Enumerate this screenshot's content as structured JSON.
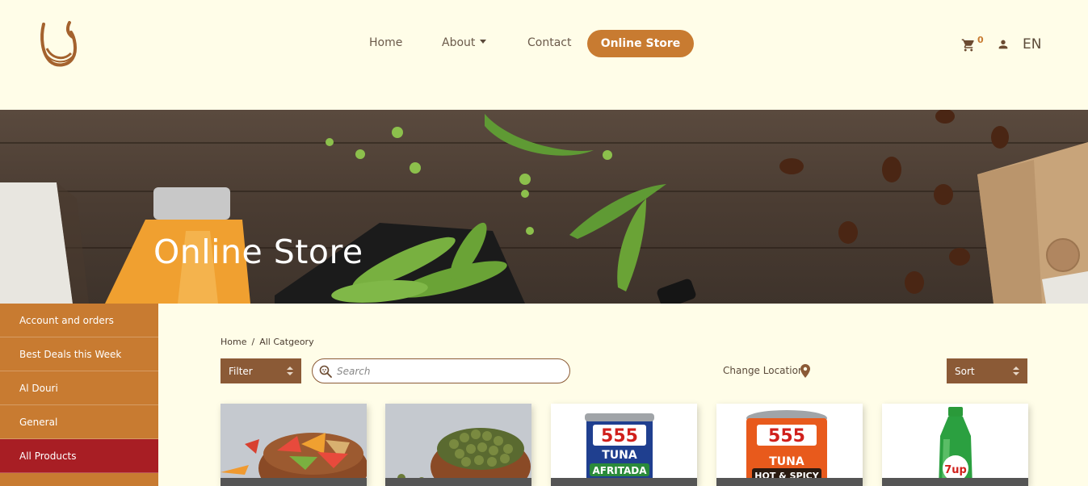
{
  "header": {
    "nav": {
      "home": "Home",
      "about": "About",
      "contact": "Contact",
      "online_store": "Online Store"
    },
    "cart_count": "0",
    "language": "EN"
  },
  "hero": {
    "title": "Online Store"
  },
  "sidebar": {
    "items": [
      {
        "label": "Account and orders"
      },
      {
        "label": "Best Deals this Week"
      },
      {
        "label": "Al Douri"
      },
      {
        "label": "General"
      },
      {
        "label": "All Products"
      }
    ],
    "active_index": 4
  },
  "breadcrumb": {
    "home": "Home",
    "separator": "/",
    "current": "All Catgeory"
  },
  "toolbar": {
    "filter_label": "Filter",
    "search_placeholder": "Search",
    "change_location": "Change Location",
    "sort_label": "Sort"
  },
  "products": [
    {
      "image": "mixed-snack-crackers-bowl"
    },
    {
      "image": "roasted-green-peas-bowl"
    },
    {
      "image": "555-tuna-afritada-can",
      "brand": "555",
      "product": "TUNA",
      "variant": "AFRITADA"
    },
    {
      "image": "555-tuna-hot-spicy-can",
      "brand": "555",
      "product": "TUNA",
      "variant": "HOT & SPICY"
    },
    {
      "image": "7up-bottle",
      "brand": "7up"
    }
  ],
  "colors": {
    "background": "#fffde8",
    "accent": "#c87b31",
    "active": "#a81e24",
    "control": "#8b5a36"
  }
}
